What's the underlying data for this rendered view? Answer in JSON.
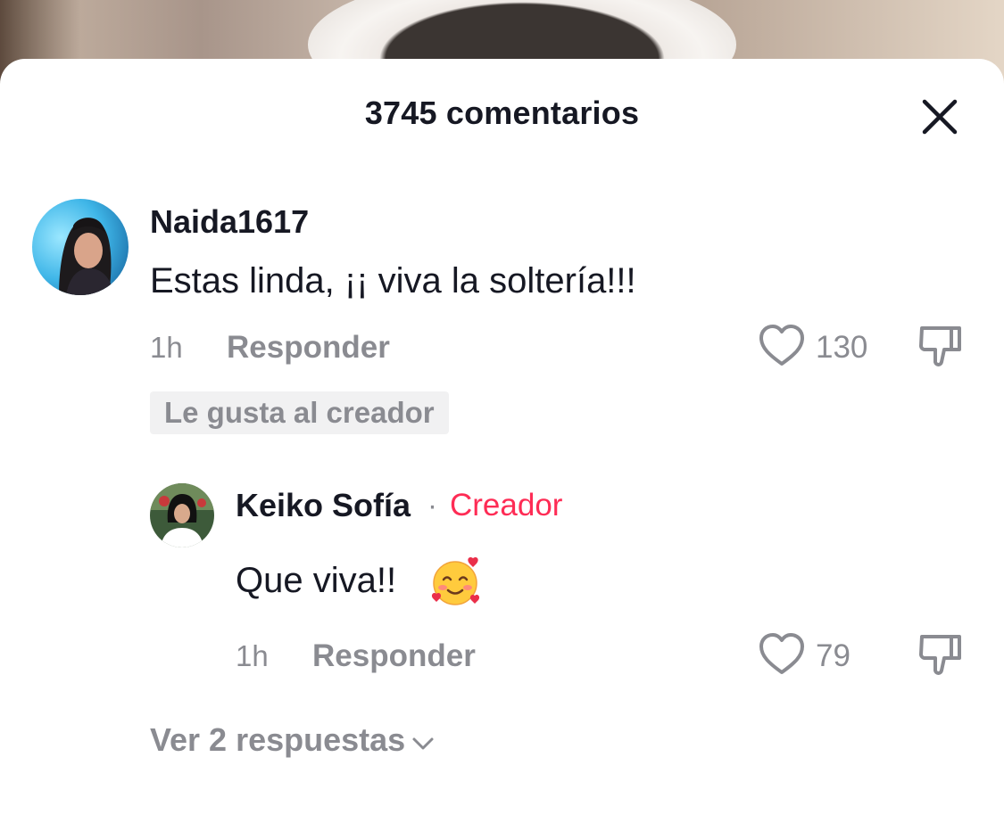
{
  "header": {
    "comment_count_label": "3745 comentarios"
  },
  "comments": [
    {
      "username": "Naida1617",
      "text": "Estas linda, ¡¡ viva la soltería!!!",
      "time": "1h",
      "reply_label": "Responder",
      "likes": "130",
      "creator_liked_label": "Le gusta al creador"
    }
  ],
  "replies": [
    {
      "username": "Keiko Sofía",
      "separator": "·",
      "badge": "Creador",
      "text": "Que viva!!",
      "emoji": "smiling-face-with-hearts-icon",
      "time": "1h",
      "reply_label": "Responder",
      "likes": "79"
    }
  ],
  "view_replies_label": "Ver 2 respuestas",
  "colors": {
    "text_primary": "#161823",
    "text_secondary": "#8a8b91",
    "creator_badge": "#fe2c55",
    "chip_bg": "#f1f1f2"
  }
}
